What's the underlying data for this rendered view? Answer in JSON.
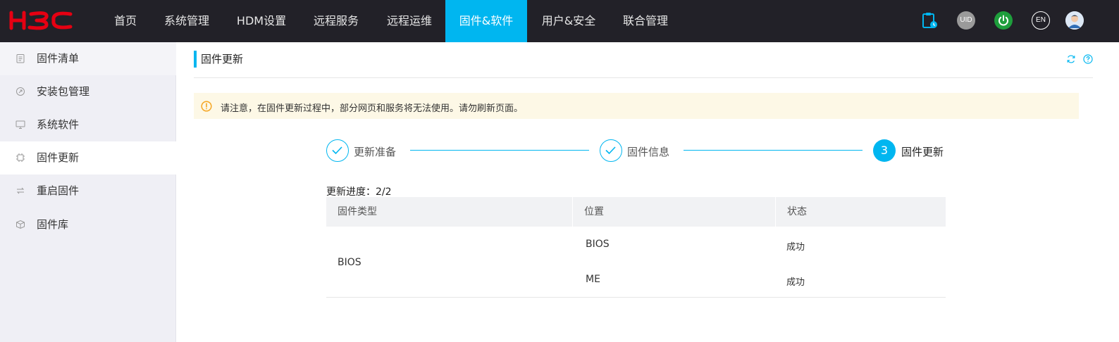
{
  "brand": {
    "logo_text": "H3C",
    "logo_color": "#e60012"
  },
  "colors": {
    "accent": "#00b6f0",
    "topbar": "#222128",
    "notice_bg": "#fdf8e6",
    "warning": "#f5a623"
  },
  "nav": {
    "items": [
      {
        "label": "首页"
      },
      {
        "label": "系统管理"
      },
      {
        "label": "HDM设置"
      },
      {
        "label": "远程服务"
      },
      {
        "label": "远程运维"
      },
      {
        "label": "固件&软件",
        "active": true
      },
      {
        "label": "用户&安全"
      },
      {
        "label": "联合管理"
      }
    ]
  },
  "top_icons": {
    "clipboard": "task-clipboard-icon",
    "uid_label": "UID",
    "power": "power-icon",
    "lang_label": "EN",
    "avatar": "user-avatar-icon"
  },
  "sidebar": {
    "items": [
      {
        "label": "固件清单",
        "icon": "clipboard-list-icon"
      },
      {
        "label": "安装包管理",
        "icon": "package-icon"
      },
      {
        "label": "系统软件",
        "icon": "monitor-icon"
      },
      {
        "label": "固件更新",
        "icon": "chip-icon",
        "active": true
      },
      {
        "label": "重启固件",
        "icon": "restart-icon"
      },
      {
        "label": "固件库",
        "icon": "cube-icon"
      }
    ]
  },
  "main": {
    "title": "固件更新",
    "notice": "请注意，在固件更新过程中，部分网页和服务将无法使用。请勿刷新页面。",
    "steps": [
      {
        "label": "更新准备",
        "status": "done"
      },
      {
        "label": "固件信息",
        "status": "done"
      },
      {
        "label": "固件更新",
        "status": "current",
        "number": "3"
      }
    ],
    "progress_label": "更新进度：2/2",
    "table": {
      "headers": [
        "固件类型",
        "位置",
        "状态"
      ],
      "group_type": "BIOS",
      "rows": [
        {
          "location": "BIOS",
          "status": "成功"
        },
        {
          "location": "ME",
          "status": "成功"
        }
      ]
    }
  }
}
